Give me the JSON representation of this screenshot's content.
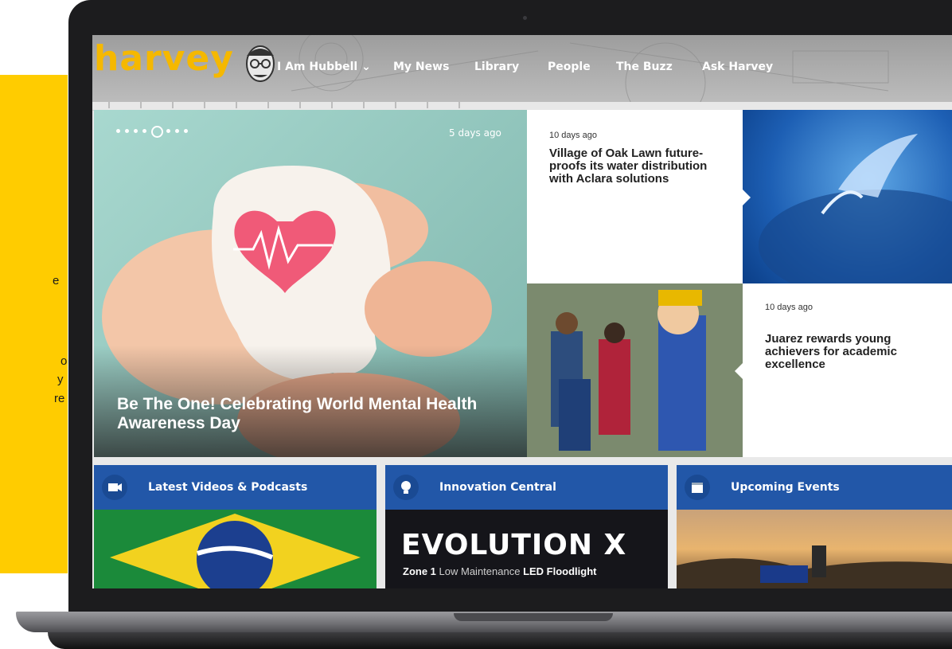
{
  "left_panel": {
    "fragments": [
      "e",
      "o",
      "y",
      "re"
    ]
  },
  "site": {
    "logo": "harvey",
    "nav": [
      "I Am Hubbell ⌄",
      "My News",
      "Library",
      "People",
      "The Buzz",
      "Ask Harvey"
    ]
  },
  "hero": {
    "date": "5 days ago",
    "title": "Be The One! Celebrating World Mental Health Awareness Day",
    "slide_count": 8,
    "active_slide": 4
  },
  "stories": [
    {
      "date": "10 days ago",
      "title": "Village of Oak Lawn future-proofs its water distribution with Aclara solutions"
    },
    {
      "date": "10 days ago",
      "title": "Juarez rewards young achievers for academic excellence"
    }
  ],
  "sections": [
    {
      "label": "Latest Videos & Podcasts",
      "icon": "video-icon"
    },
    {
      "label": "Innovation Central",
      "icon": "lightbulb-icon",
      "promo_title": "EVOLUTION X",
      "promo_subtitle_bold": "Zone 1",
      "promo_subtitle_light": "Low Maintenance",
      "promo_subtitle_end": "LED Floodlight"
    },
    {
      "label": "Upcoming Events",
      "icon": "calendar-icon"
    }
  ],
  "colors": {
    "accent_yellow": "#ffcc00",
    "brand_blue": "#2257a8",
    "logo_gold": "#f5b800"
  }
}
